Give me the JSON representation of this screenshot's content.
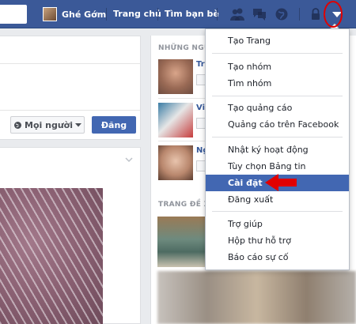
{
  "topbar": {
    "profile_name": "Ghé Gớm",
    "nav_home": "Trang chủ",
    "nav_find_friends": "Tìm bạn bè",
    "icons": [
      "friend-requests-icon",
      "messages-icon",
      "notifications-globe-icon",
      "privacy-lock-icon",
      "account-menu-arrow-icon"
    ],
    "bar_color": "#3b5998"
  },
  "composer": {
    "audience_label": "Mọi người",
    "post_label": "Đăng"
  },
  "right_column": {
    "pymk_title": "NHỮNG NGƯỜI",
    "pymk_names": [
      "Tr",
      "Vi",
      "Ng"
    ],
    "suggested_pages_title": "TRANG ĐỀ XI"
  },
  "account_menu": {
    "groups": [
      [
        "Tạo Trang"
      ],
      [
        "Tạo nhóm",
        "Tìm nhóm"
      ],
      [
        "Tạo quảng cáo",
        "Quảng cáo trên Facebook"
      ],
      [
        "Nhật ký hoạt động",
        "Tùy chọn Bảng tin",
        "Cài đặt",
        "Đăng xuất"
      ],
      [
        "Trợ giúp",
        "Hộp thư hỗ trợ",
        "Báo cáo sự cố"
      ]
    ],
    "highlighted_item": "Cài đặt",
    "highlight_color": "#4267b2"
  },
  "annotations": {
    "color": "#e00000"
  }
}
